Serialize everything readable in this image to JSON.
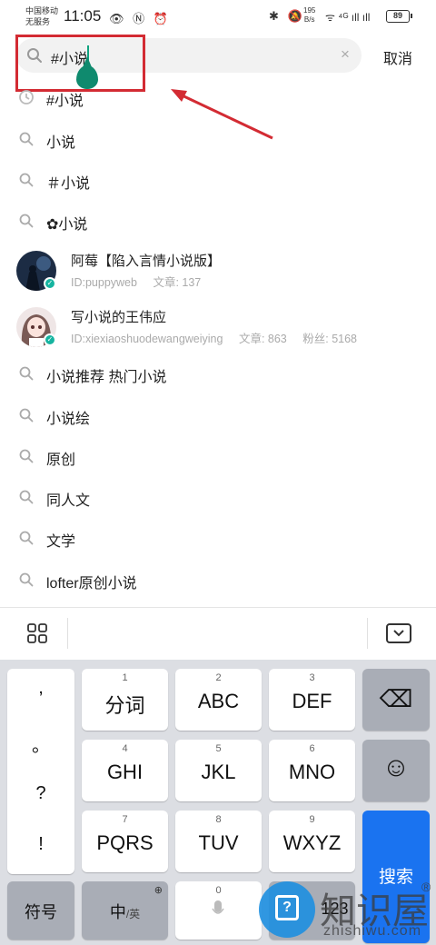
{
  "status_bar": {
    "carrier_line1": "中国移动",
    "carrier_line2": "无服务",
    "time": "11:05",
    "left_icons": "👁 Ⓝ ⏰",
    "net_speed_value": "195",
    "net_speed_unit": "B/s",
    "right_icons": "✱ 🔕",
    "signal_icons": "ᯤ ⁴ᴳ ıll ıll",
    "battery": "89"
  },
  "search": {
    "query": "#小说",
    "cancel_label": "取消",
    "clear_icon": "×"
  },
  "suggestions": [
    {
      "label": "#小说",
      "icon": "history-icon"
    },
    {
      "label": "小说",
      "icon": "search-icon"
    },
    {
      "label": "＃小说",
      "icon": "search-icon"
    },
    {
      "label": "✿小说",
      "icon": "search-icon"
    }
  ],
  "users": [
    {
      "name": "阿莓【陷入言情小说版】",
      "id": "ID:puppyweb",
      "articles": "文章: 137",
      "fans": ""
    },
    {
      "name": "写小说的王伟应",
      "id": "ID:xiexiaoshuodewangweiying",
      "articles": "文章: 863",
      "fans": "粉丝: 5168"
    }
  ],
  "more_suggestions": [
    {
      "label": "小说推荐 热门小说"
    },
    {
      "label": "小说绘"
    },
    {
      "label": "原创"
    },
    {
      "label": "同人文"
    },
    {
      "label": "文学"
    },
    {
      "label": "lofter原创小说"
    }
  ],
  "keyboard": {
    "punct": [
      ",",
      "。",
      "?",
      "!"
    ],
    "rows": [
      [
        {
          "num": "1",
          "main": "分词"
        },
        {
          "num": "2",
          "main": "ABC"
        },
        {
          "num": "3",
          "main": "DEF"
        }
      ],
      [
        {
          "num": "4",
          "main": "GHI"
        },
        {
          "num": "5",
          "main": "JKL"
        },
        {
          "num": "6",
          "main": "MNO"
        }
      ],
      [
        {
          "num": "7",
          "main": "PQRS"
        },
        {
          "num": "8",
          "main": "TUV"
        },
        {
          "num": "9",
          "main": "WXYZ"
        }
      ]
    ],
    "backspace_icon": "⌫",
    "emoji_icon": "☺",
    "search_label": "搜索",
    "symbols_label": "符号",
    "zh_label": "中",
    "en_label": "/英",
    "space_num": "0",
    "num_label": "123"
  },
  "watermark": {
    "text": "知识屋",
    "reg": "®",
    "url": "zhishiwu.com",
    "q": "?"
  }
}
